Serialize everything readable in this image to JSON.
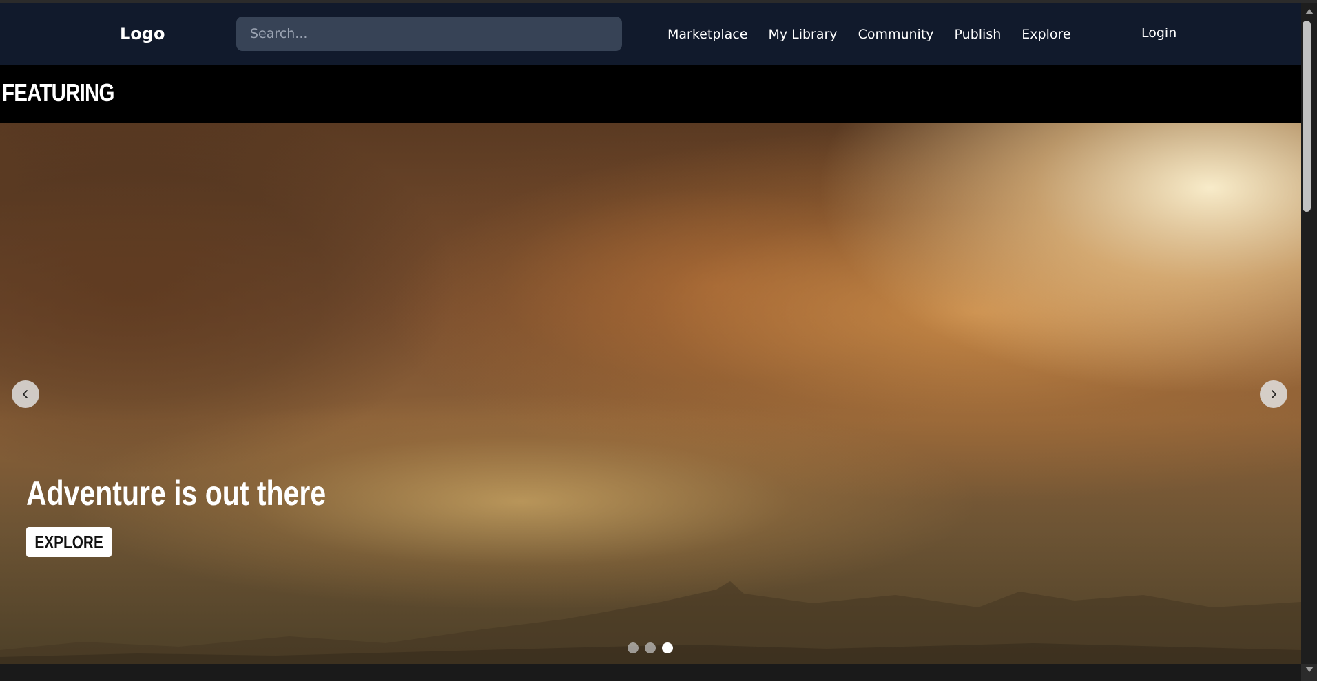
{
  "navbar": {
    "logo": "Logo",
    "search_placeholder": "Search...",
    "links": [
      "Marketplace",
      "My Library",
      "Community",
      "Publish",
      "Explore"
    ],
    "login": "Login"
  },
  "featuring": {
    "heading": "FEATURING"
  },
  "carousel": {
    "slide_title": "Adventure is out there",
    "button_label": "EXPLORE",
    "prev_icon": "chevron-left-icon",
    "next_icon": "chevron-right-icon",
    "total_slides": 3,
    "active_slide": 3
  },
  "colors": {
    "navbar_bg": "#111a2c",
    "search_bg": "#374356",
    "page_bg": "#000000",
    "button_bg": "#ffffff"
  }
}
